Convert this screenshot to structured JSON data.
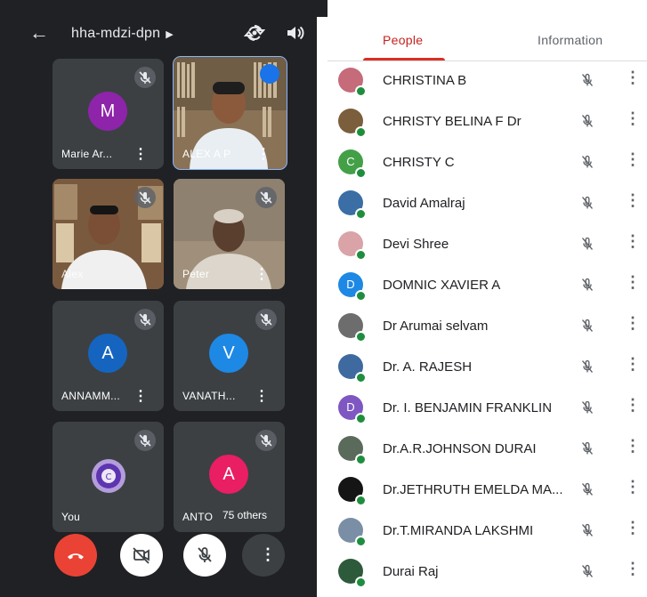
{
  "meeting": {
    "code": "hha-mdzi-dpn",
    "others_count_label": "75 others",
    "tiles": [
      {
        "name": "Marie Ar...",
        "initial": "M",
        "avatar_color": "#8e24aa"
      },
      {
        "name": "ALEX A P",
        "video": true,
        "speaking": true
      },
      {
        "name": "Alex",
        "video": true
      },
      {
        "name": "Peter",
        "video": true
      },
      {
        "name": "ANNAMM...",
        "initial": "A",
        "avatar_color": "#1565c0"
      },
      {
        "name": "VANATH...",
        "initial": "V",
        "avatar_color": "#1e88e5"
      },
      {
        "name": "You",
        "logo": true
      },
      {
        "name": "ANTO",
        "initial": "A",
        "avatar_color": "#e91e63"
      }
    ],
    "controls": [
      "end-call",
      "camera-off",
      "mic-off",
      "more-options"
    ],
    "colors": {
      "end_call": "#ea4335",
      "speaking_ring": "#8ab4f8"
    }
  },
  "people_panel": {
    "tabs": [
      {
        "label": "People",
        "active": true
      },
      {
        "label": "Information",
        "active": false
      }
    ],
    "participants": [
      {
        "name": "CHRISTINA B",
        "avatar": "photo",
        "color": "#c56b7a"
      },
      {
        "name": "CHRISTY BELINA F Dr",
        "avatar": "photo",
        "color": "#7b5e3b"
      },
      {
        "name": "CHRISTY C",
        "avatar": "C",
        "color": "#43a047"
      },
      {
        "name": "David Amalraj",
        "avatar": "photo",
        "color": "#3a6ea5"
      },
      {
        "name": "Devi Shree",
        "avatar": "photo",
        "color": "#d9a3a8"
      },
      {
        "name": "DOMNIC XAVIER A",
        "avatar": "D",
        "color": "#1e88e5"
      },
      {
        "name": "Dr Arumai selvam",
        "avatar": "photo",
        "color": "#6d6d6d"
      },
      {
        "name": "Dr. A. RAJESH",
        "avatar": "photo",
        "color": "#3f6aa0"
      },
      {
        "name": "Dr. I. BENJAMIN FRANKLIN",
        "avatar": "D",
        "color": "#7e57c2"
      },
      {
        "name": "Dr.A.R.JOHNSON DURAI",
        "avatar": "photo",
        "color": "#5b6b5b"
      },
      {
        "name": "Dr.JETHRUTH EMELDA MA...",
        "avatar": "photo",
        "color": "#151515"
      },
      {
        "name": "Dr.T.MIRANDA LAKSHMI",
        "avatar": "photo",
        "color": "#7a8fa6"
      },
      {
        "name": "Durai Raj",
        "avatar": "photo",
        "color": "#2e5a3c"
      }
    ]
  }
}
